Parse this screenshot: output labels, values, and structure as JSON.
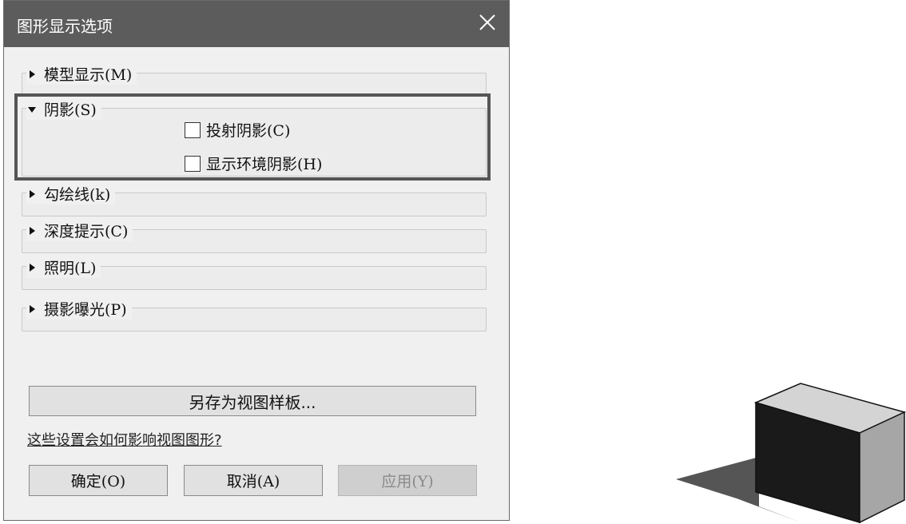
{
  "dialog": {
    "title": "图形显示选项",
    "sections": [
      {
        "label": "模型显示(M)",
        "expanded": false
      },
      {
        "label": "阴影(S)",
        "expanded": true
      },
      {
        "label": "勾绘线(k)",
        "expanded": false
      },
      {
        "label": "深度提示(C)",
        "expanded": false
      },
      {
        "label": "照明(L)",
        "expanded": false
      },
      {
        "label": "摄影曝光(P)",
        "expanded": false
      }
    ],
    "shadow_options": [
      {
        "label": "投射阴影(C)",
        "checked": false
      },
      {
        "label": "显示环境阴影(H)",
        "checked": false
      }
    ],
    "save_template_label": "另存为视图样板...",
    "help_link_text": "这些设置会如何影响视图图形?",
    "buttons": {
      "ok": "确定(O)",
      "cancel": "取消(A)",
      "apply": "应用(Y)"
    }
  },
  "colors": {
    "titlebar": "#5c5c5c",
    "dialog_bg": "#f0f0f0",
    "highlight_border": "#555555"
  }
}
